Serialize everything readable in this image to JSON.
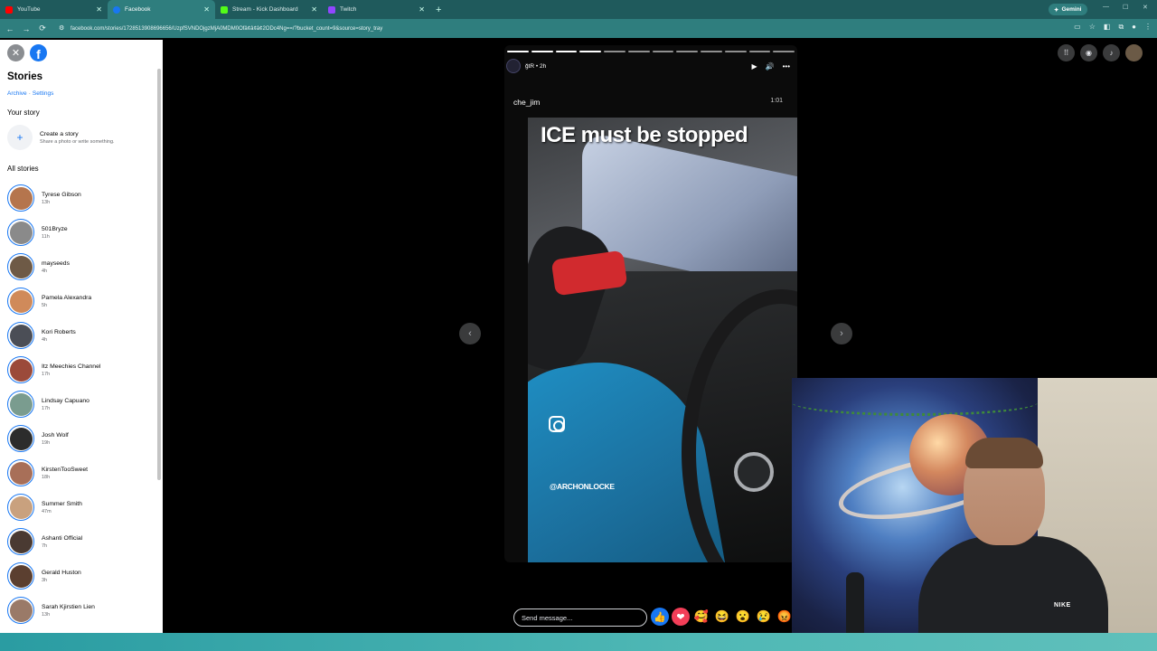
{
  "browser": {
    "tabs": [
      {
        "label": "YouTube",
        "color": "#ff0000"
      },
      {
        "label": "Facebook",
        "color": "#1877f2",
        "active": true
      },
      {
        "label": "Stream - Kick Dashboard",
        "color": "#53fc18"
      },
      {
        "label": "Twitch",
        "color": "#9146ff"
      }
    ],
    "new_tab": "+",
    "gemini_label": "Gemini",
    "url": "facebook.com/stories/1728513908696656/UzpfSVNDOjgzMjA0MDM0Ofâ¢â¢â¢2ODc4Ng==/?bucket_count=9&source=story_tray"
  },
  "sidebar": {
    "title": "Stories",
    "links": [
      "Archive",
      "Settings"
    ],
    "your_story_heading": "Your story",
    "create": {
      "title": "Create a story",
      "subtitle": "Share a photo or write something."
    },
    "all_stories_heading": "All stories",
    "stories": [
      {
        "name": "Tyrese Gibson",
        "time": "13h",
        "color": "#b5754d"
      },
      {
        "name": "501Bryze",
        "time": "11h",
        "color": "#8a8a8a"
      },
      {
        "name": "mayseeds",
        "time": "4h",
        "color": "#6e5a46"
      },
      {
        "name": "Pamela Alexandra",
        "time": "5h",
        "color": "#d08a5a"
      },
      {
        "name": "Kori Roberts",
        "time": "4h",
        "color": "#4b4e56"
      },
      {
        "name": "Itz Meechies Channel",
        "time": "17h",
        "color": "#9b4a3a"
      },
      {
        "name": "Lindsay Capuano",
        "time": "17h",
        "color": "#7a9c8f"
      },
      {
        "name": "Josh Wolf",
        "time": "19h",
        "color": "#2c2c2c"
      },
      {
        "name": "KirstenTooSweet",
        "time": "18h",
        "color": "#a86f58"
      },
      {
        "name": "Summer Smith",
        "time": "47m",
        "color": "#c9a17e"
      },
      {
        "name": "Ashanti Official",
        "time": "7h",
        "color": "#4a3a32"
      },
      {
        "name": "Gerald Huston",
        "time": "3h",
        "color": "#5b3f30"
      },
      {
        "name": "Sarah Kjirstien Lien",
        "time": "13h",
        "color": "#9a7a68"
      }
    ]
  },
  "viewer": {
    "header_name": "ğtR • 2h",
    "username": "che_jim",
    "duration": "1:01",
    "caption": "ICE must be stopped",
    "handle": "@ARCHONLOCKE",
    "sticker_emojis": [
      "✋",
      "🧊",
      "🧊",
      "🧊"
    ],
    "progress_total": 12,
    "progress_done": 4,
    "reply_placeholder": "Send message...",
    "reactions": [
      "👍",
      "❤",
      "🥰",
      "😆",
      "😮",
      "😢",
      "😡"
    ]
  },
  "webcam": {
    "shirt_logo": "NIKE"
  }
}
